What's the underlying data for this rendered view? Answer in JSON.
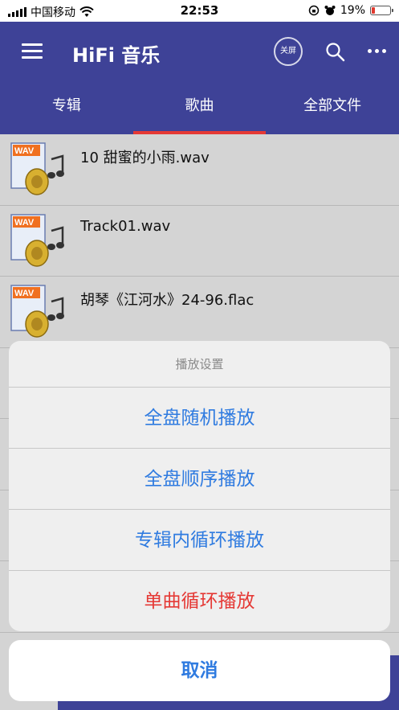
{
  "status_bar": {
    "carrier": "中国移动",
    "time": "22:53",
    "battery": "19%"
  },
  "header": {
    "title": "HiFi 音乐",
    "screen_button_label": "关屏"
  },
  "tabs": [
    {
      "label": "专辑",
      "active": false
    },
    {
      "label": "歌曲",
      "active": true
    },
    {
      "label": "全部文件",
      "active": false
    }
  ],
  "songs": [
    {
      "title": "10 甜蜜的小雨.wav"
    },
    {
      "title": "Track01.wav"
    },
    {
      "title": "胡琴《江河水》24-96.flac"
    }
  ],
  "action_sheet": {
    "title": "播放设置",
    "options": [
      {
        "label": "全盘随机播放"
      },
      {
        "label": "全盘顺序播放"
      },
      {
        "label": "专辑内循环播放"
      },
      {
        "label": "单曲循环播放"
      }
    ],
    "cancel_label": "取消"
  },
  "colors": {
    "header_bg": "#3e4297",
    "tab_indicator": "#e53935",
    "action_blue": "#2f7be0",
    "action_red": "#e53935"
  }
}
